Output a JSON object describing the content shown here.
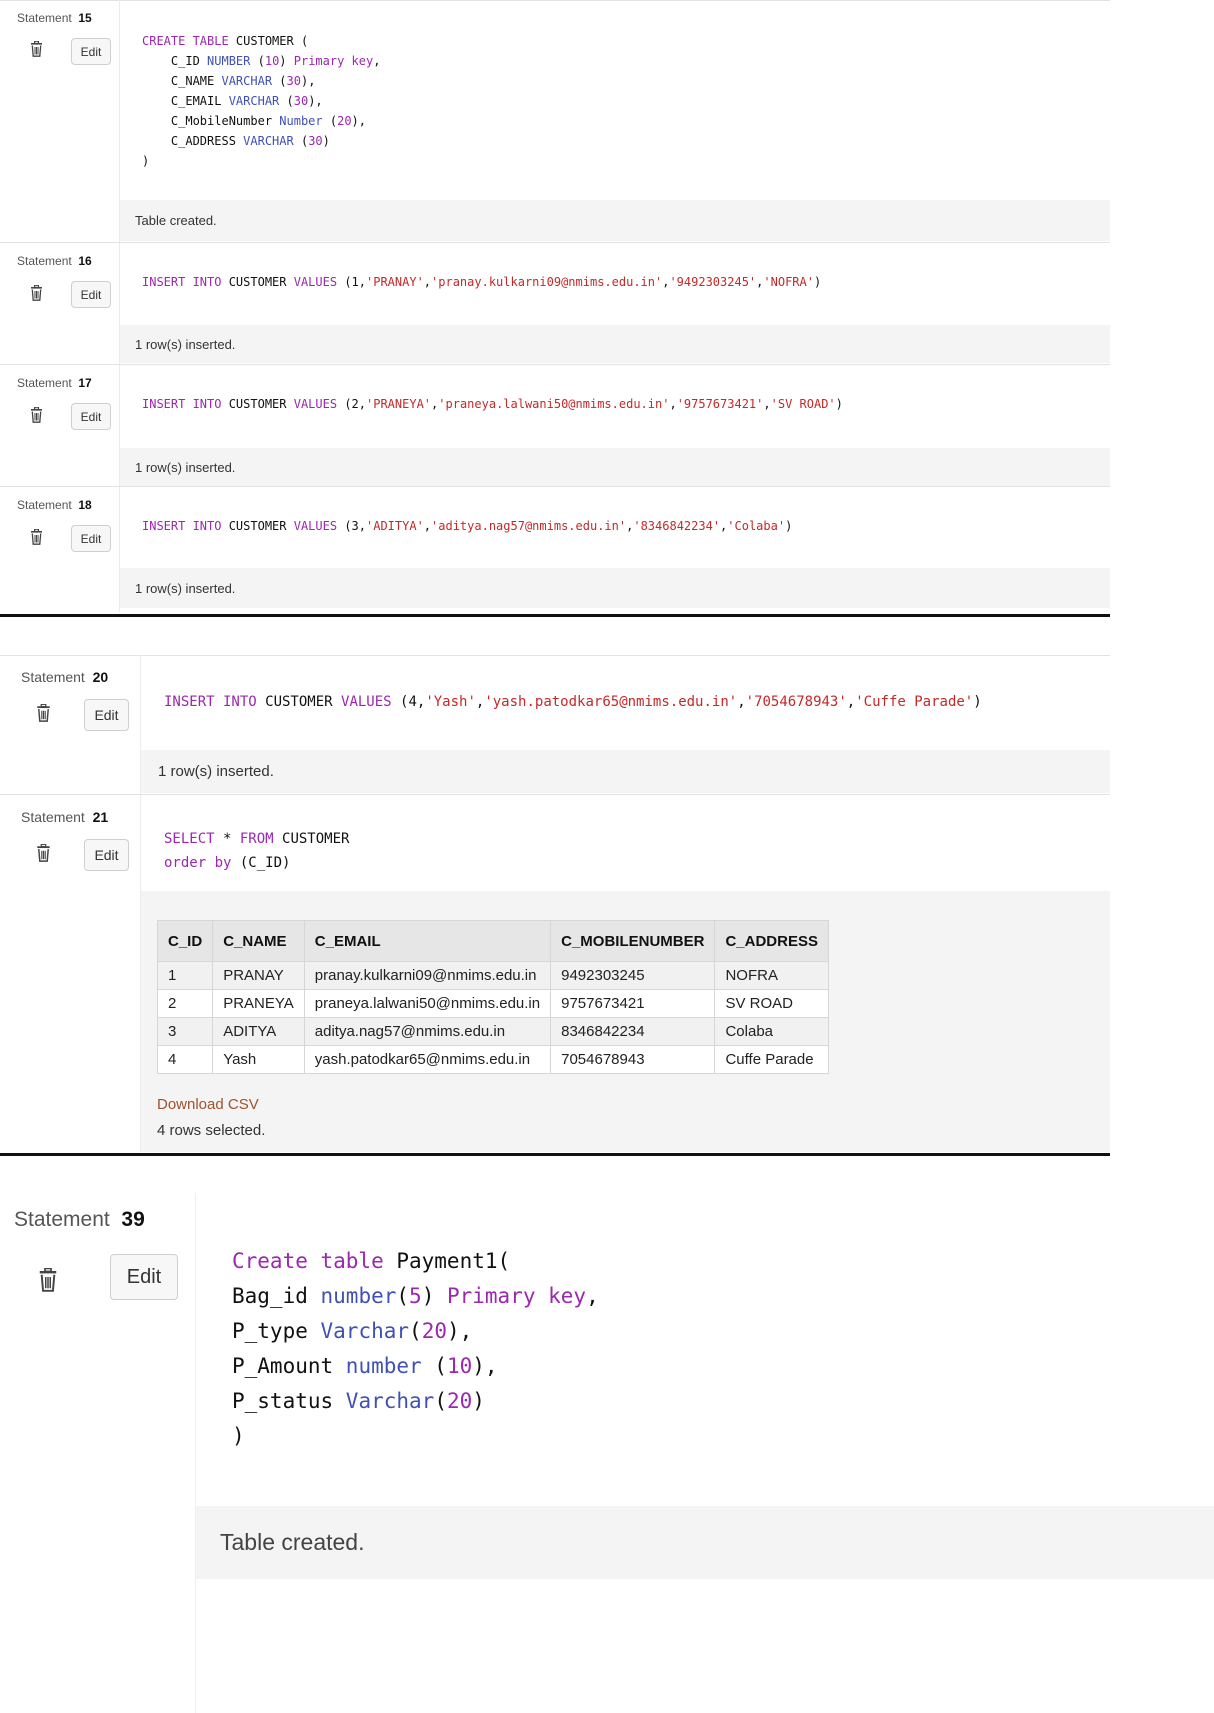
{
  "common": {
    "statement_label": "Statement",
    "edit_label": "Edit"
  },
  "s15": {
    "number": "15",
    "code": [
      [
        [
          "k",
          "CREATE TABLE"
        ],
        [
          "p",
          " CUSTOMER ("
        ]
      ],
      [
        [
          "p",
          "    C_ID "
        ],
        [
          "t",
          "NUMBER"
        ],
        [
          "p",
          " ("
        ],
        [
          "n",
          "10"
        ],
        [
          "p",
          ") "
        ],
        [
          "k",
          "Primary key"
        ],
        [
          "p",
          ","
        ]
      ],
      [
        [
          "p",
          "    C_NAME "
        ],
        [
          "t",
          "VARCHAR"
        ],
        [
          "p",
          " ("
        ],
        [
          "n",
          "30"
        ],
        [
          "p",
          "),"
        ]
      ],
      [
        [
          "p",
          "    C_EMAIL "
        ],
        [
          "t",
          "VARCHAR"
        ],
        [
          "p",
          " ("
        ],
        [
          "n",
          "30"
        ],
        [
          "p",
          "),"
        ]
      ],
      [
        [
          "p",
          "    C_MobileNumber "
        ],
        [
          "t",
          "Number"
        ],
        [
          "p",
          " ("
        ],
        [
          "n",
          "20"
        ],
        [
          "p",
          "),"
        ]
      ],
      [
        [
          "p",
          "    C_ADDRESS "
        ],
        [
          "t",
          "VARCHAR"
        ],
        [
          "p",
          " ("
        ],
        [
          "n",
          "30"
        ],
        [
          "p",
          ")"
        ]
      ],
      [
        [
          "p",
          ")"
        ]
      ]
    ],
    "result": "Table created."
  },
  "s16": {
    "number": "16",
    "code": [
      [
        [
          "k",
          "INSERT INTO"
        ],
        [
          "p",
          " CUSTOMER "
        ],
        [
          "k",
          "VALUES"
        ],
        [
          "p",
          " (1,"
        ],
        [
          "s",
          "'PRANAY'"
        ],
        [
          "p",
          ","
        ],
        [
          "s",
          "'pranay.kulkarni09@nmims.edu.in'"
        ],
        [
          "p",
          ","
        ],
        [
          "s",
          "'9492303245'"
        ],
        [
          "p",
          ","
        ],
        [
          "s",
          "'NOFRA'"
        ],
        [
          "p",
          ")"
        ]
      ]
    ],
    "result": "1 row(s) inserted."
  },
  "s17": {
    "number": "17",
    "code": [
      [
        [
          "k",
          "INSERT INTO"
        ],
        [
          "p",
          " CUSTOMER "
        ],
        [
          "k",
          "VALUES"
        ],
        [
          "p",
          " (2,"
        ],
        [
          "s",
          "'PRANEYA'"
        ],
        [
          "p",
          ","
        ],
        [
          "s",
          "'praneya.lalwani50@nmims.edu.in'"
        ],
        [
          "p",
          ","
        ],
        [
          "s",
          "'9757673421'"
        ],
        [
          "p",
          ","
        ],
        [
          "s",
          "'SV ROAD'"
        ],
        [
          "p",
          ")"
        ]
      ]
    ],
    "result": "1 row(s) inserted."
  },
  "s18": {
    "number": "18",
    "code": [
      [
        [
          "k",
          "INSERT INTO"
        ],
        [
          "p",
          " CUSTOMER "
        ],
        [
          "k",
          "VALUES"
        ],
        [
          "p",
          " (3,"
        ],
        [
          "s",
          "'ADITYA'"
        ],
        [
          "p",
          ","
        ],
        [
          "s",
          "'aditya.nag57@nmims.edu.in'"
        ],
        [
          "p",
          ","
        ],
        [
          "s",
          "'8346842234'"
        ],
        [
          "p",
          ","
        ],
        [
          "s",
          "'Colaba'"
        ],
        [
          "p",
          ")"
        ]
      ]
    ],
    "result": "1 row(s) inserted."
  },
  "s20": {
    "number": "20",
    "code": [
      [
        [
          "k",
          "INSERT INTO"
        ],
        [
          "p",
          " CUSTOMER "
        ],
        [
          "k",
          "VALUES"
        ],
        [
          "p",
          " (4,"
        ],
        [
          "s",
          "'Yash'"
        ],
        [
          "p",
          ","
        ],
        [
          "s",
          "'yash.patodkar65@nmims.edu.in'"
        ],
        [
          "p",
          ","
        ],
        [
          "s",
          "'7054678943'"
        ],
        [
          "p",
          ","
        ],
        [
          "s",
          "'Cuffe Parade'"
        ],
        [
          "p",
          ")"
        ]
      ]
    ],
    "result": "1 row(s) inserted."
  },
  "s21": {
    "number": "21",
    "code": [
      [
        [
          "k",
          "SELECT"
        ],
        [
          "p",
          " * "
        ],
        [
          "k",
          "FROM"
        ],
        [
          "p",
          " CUSTOMER"
        ]
      ],
      [
        [
          "k",
          "order by"
        ],
        [
          "p",
          " (C_ID)"
        ]
      ]
    ],
    "table": {
      "columns": [
        "C_ID",
        "C_NAME",
        "C_EMAIL",
        "C_MOBILENUMBER",
        "C_ADDRESS"
      ],
      "rows": [
        [
          "1",
          "PRANAY",
          "pranay.kulkarni09@nmims.edu.in",
          "9492303245",
          "NOFRA"
        ],
        [
          "2",
          "PRANEYA",
          "praneya.lalwani50@nmims.edu.in",
          "9757673421",
          "SV ROAD"
        ],
        [
          "3",
          "ADITYA",
          "aditya.nag57@nmims.edu.in",
          "8346842234",
          "Colaba"
        ],
        [
          "4",
          "Yash",
          "yash.patodkar65@nmims.edu.in",
          "7054678943",
          "Cuffe Parade"
        ]
      ]
    },
    "download_label": "Download CSV",
    "result": "4 rows selected."
  },
  "s39": {
    "number": "39",
    "code": [
      [
        [
          "k",
          "Create table"
        ],
        [
          "p",
          " Payment1("
        ]
      ],
      [
        [
          "p",
          "Bag_id "
        ],
        [
          "t",
          "number"
        ],
        [
          "p",
          "("
        ],
        [
          "n",
          "5"
        ],
        [
          "p",
          ") "
        ],
        [
          "k",
          "Primary key"
        ],
        [
          "p",
          ","
        ]
      ],
      [
        [
          "p",
          "P_type "
        ],
        [
          "t",
          "Varchar"
        ],
        [
          "p",
          "("
        ],
        [
          "n",
          "20"
        ],
        [
          "p",
          "),"
        ]
      ],
      [
        [
          "p",
          "P_Amount "
        ],
        [
          "t",
          "number"
        ],
        [
          "p",
          " ("
        ],
        [
          "n",
          "10"
        ],
        [
          "p",
          "),"
        ]
      ],
      [
        [
          "p",
          "P_status "
        ],
        [
          "t",
          "Varchar"
        ],
        [
          "p",
          "("
        ],
        [
          "n",
          "20"
        ],
        [
          "p",
          ")"
        ]
      ],
      [
        [
          "p",
          ")"
        ]
      ]
    ],
    "result": "Table created."
  },
  "colors": {
    "keyword": "#9c27b0",
    "type": "#3f51b5",
    "string": "#c62828",
    "link": "#a0522d"
  }
}
